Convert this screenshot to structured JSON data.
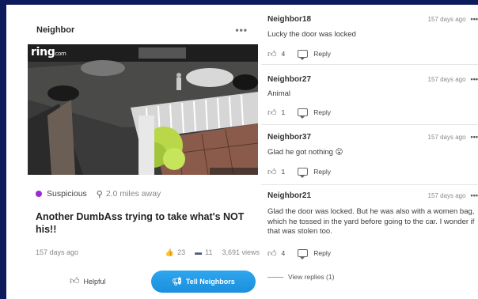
{
  "post": {
    "card_title": "Neighbor",
    "more": "•••",
    "video_logo": "ring",
    "video_logo_sub": "com",
    "category": "Suspicious",
    "category_color": "#9d2ad6",
    "distance": "2.0 miles away",
    "headline": "Another DumbAss trying to take what's NOT his!!",
    "age": "157 days ago",
    "likes": "23",
    "comments_count": "11",
    "views": "3,691 views",
    "helpful_label": "Helpful",
    "tell_label": "Tell Neighbors",
    "tell_color": "#1da1f2"
  },
  "comments": [
    {
      "name": "Neighbor18",
      "time": "157 days ago",
      "text": "Lucky the door was locked",
      "likes": "4",
      "reply": "Reply"
    },
    {
      "name": "Neighbor27",
      "time": "157 days ago",
      "text": "Animal",
      "likes": "1",
      "reply": "Reply"
    },
    {
      "name": "Neighbor37",
      "time": "157 days ago",
      "text": "Glad he got nothing 😮",
      "likes": "1",
      "reply": "Reply"
    },
    {
      "name": "Neighbor21",
      "time": "157 days ago",
      "text": "Glad the door was locked. But he was also with a women bag, which he tossed in the yard before going to the car. I wonder if that was stolen too.",
      "likes": "4",
      "reply": "Reply"
    }
  ],
  "view_replies": "View replies (1)",
  "icons": [
    "more-icon",
    "ring-logo",
    "location-pin-icon",
    "thumbs-up-icon",
    "comment-icon",
    "megaphone-icon",
    "reply-bubble-icon"
  ]
}
